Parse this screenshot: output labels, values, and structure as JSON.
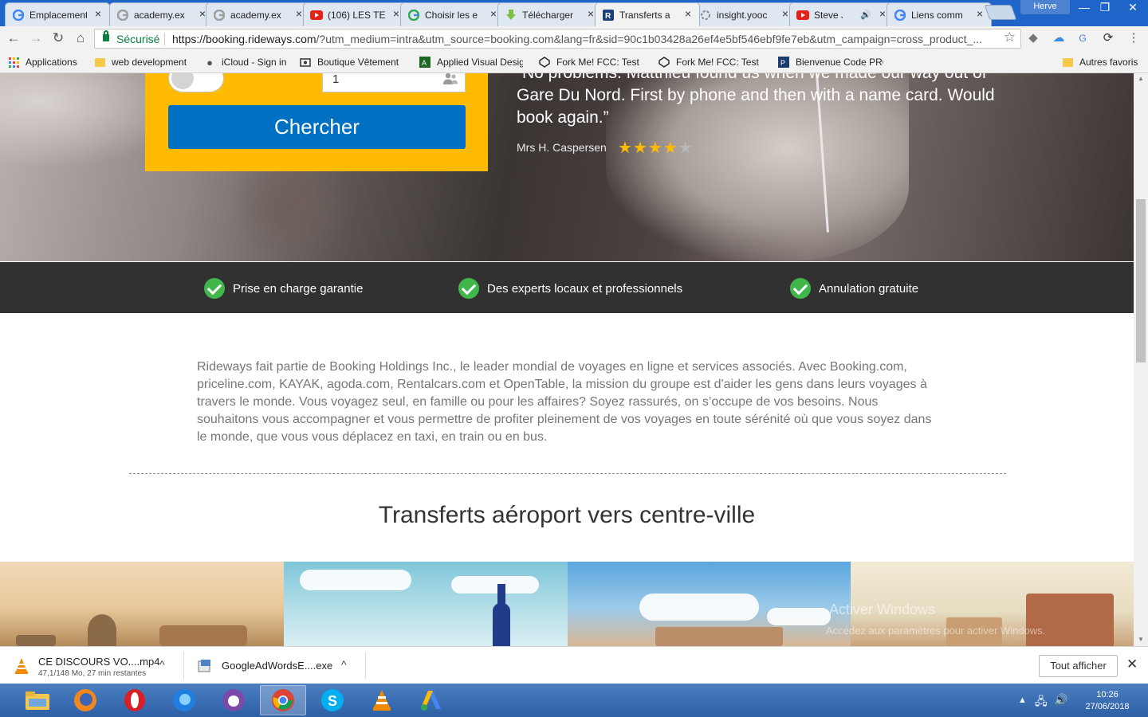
{
  "tabs": [
    {
      "title": "Emplacement",
      "icon": "google-icon"
    },
    {
      "title": "academy.ex",
      "icon": "google-icon"
    },
    {
      "title": "academy.ex",
      "icon": "google-icon"
    },
    {
      "title": "(106) LES TE",
      "icon": "youtube-icon"
    },
    {
      "title": "Choisir les e",
      "icon": "google-icon"
    },
    {
      "title": "Télécharger",
      "icon": "download-icon"
    },
    {
      "title": "Transferts a",
      "icon": "rideways-icon"
    },
    {
      "title": "insight.yooc",
      "icon": "spinner-icon"
    },
    {
      "title": "Steve Jo",
      "icon": "youtube-icon"
    },
    {
      "title": "Liens comm",
      "icon": "google-icon"
    }
  ],
  "window": {
    "user": "Herve",
    "minimize": "—",
    "restore": "❐",
    "close": "✕"
  },
  "toolbar": {
    "secure_label": "Sécurisé",
    "url_host": "https://booking.rideways.com",
    "url_rest": "/?utm_medium=intra&utm_source=booking.com&lang=fr&sid=90c1b03428a26ef4e5bf546ebf9fe7eb&utm_campaign=cross_product_..."
  },
  "bookmarks": [
    {
      "label": "Applications",
      "icon": "apps-grid-icon"
    },
    {
      "label": "web development",
      "icon": "folder-icon"
    },
    {
      "label": "iCloud - Sign in",
      "icon": "apple-icon"
    },
    {
      "label": "Boutique Vêtement",
      "icon": "store-icon"
    },
    {
      "label": "Applied Visual Desig",
      "icon": "fcc-icon"
    },
    {
      "label": "Fork Me! FCC: Test S",
      "icon": "codepen-icon"
    },
    {
      "label": "Fork Me! FCC: Test S",
      "icon": "codepen-icon"
    },
    {
      "label": "Bienvenue Code PRO",
      "icon": "codepro-icon"
    }
  ],
  "bookmarks_other": "Autres favoris",
  "search_form": {
    "passengers": "1",
    "search_button": "Chercher"
  },
  "review": {
    "quote": "“No problems. Matthieu found us when we made our way out of Gare Du Nord. First by phone and then with a name card. Would book again.”",
    "author": "Mrs H. Caspersen",
    "rating": 4,
    "rating_max": 5
  },
  "usps": [
    "Prise en charge garantie",
    "Des experts locaux et professionnels",
    "Annulation gratuite"
  ],
  "about_text": "Rideways fait partie de Booking Holdings Inc., le leader mondial de voyages en ligne et services associés. Avec Booking.com, priceline.com, KAYAK, agoda.com, Rentalcars.com et OpenTable, la mission du groupe est d'aider les gens dans leurs voyages à travers le monde. Vous voyagez seul, en famille ou pour les affaires? Soyez rassurés, on s’occupe de vos besoins. Nous souhaitons vous accompagner et vous permettre de profiter pleinement de vos voyages en toute sérénité où que vous soyez dans le monde, que vous vous déplacez en taxi, en train ou en bus.",
  "section_title": "Transferts aéroport vers centre-ville",
  "watermark": {
    "line1": "Activer Windows",
    "line2": "Accédez aux paramètres pour activer Windows."
  },
  "downloads": [
    {
      "name": "CE DISCOURS VO....mp4",
      "status": "47,1/148 Mo, 27 min restantes",
      "icon": "vlc-icon"
    },
    {
      "name": "GoogleAdWordsE....exe",
      "status": "",
      "icon": "installer-icon"
    }
  ],
  "show_all": "Tout afficher",
  "clock": {
    "time": "10:26",
    "date": "27/06/2018"
  },
  "colors": {
    "brand_yellow": "#febb02",
    "brand_blue": "#0071c2",
    "usp_bar": "#313131",
    "check_green": "#41b64a"
  }
}
